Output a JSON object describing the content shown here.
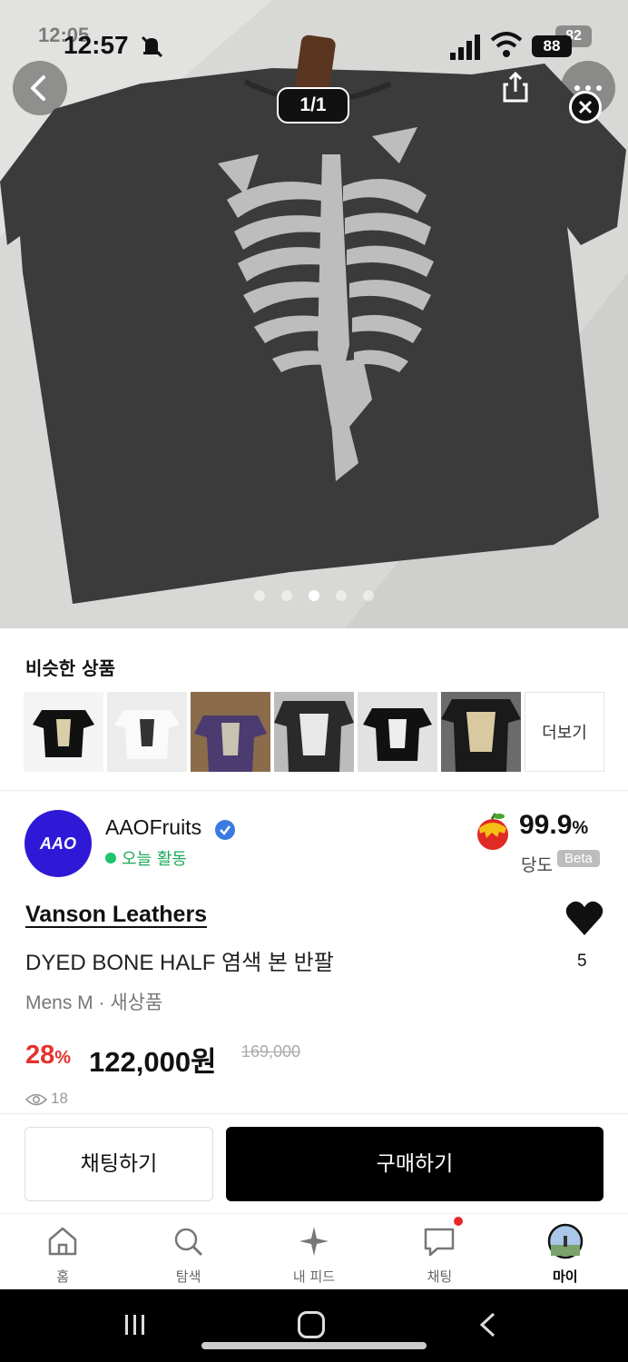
{
  "status_bar": {
    "time": "12:57",
    "time_ghost": "12:05",
    "battery": "88",
    "battery_ghost": "82"
  },
  "hero": {
    "counter": "1/1",
    "dots_count": 5,
    "active_dot": 2
  },
  "similar": {
    "title": "비슷한 상품",
    "more_label": "더보기"
  },
  "seller": {
    "avatar_text": "AAO",
    "name": "AAOFruits",
    "online_text": "오늘 활동",
    "rating_value": "99.9",
    "rating_unit": "%",
    "sweetness_label": "당도",
    "beta_label": "Beta"
  },
  "product": {
    "brand": "Vanson Leathers",
    "name": "DYED BONE HALF 염색 본 반팔",
    "meta": "Mens M · 새상품",
    "discount_value": "28",
    "discount_unit": "%",
    "price": "122,000원",
    "original_price": "169,000",
    "likes": "5",
    "views": "18"
  },
  "actions": {
    "chat_label": "채팅하기",
    "buy_label": "구매하기"
  },
  "nav": {
    "items": [
      {
        "label": "홈",
        "icon": "home-icon"
      },
      {
        "label": "탐색",
        "icon": "search-icon"
      },
      {
        "label": "내 피드",
        "icon": "sparkle-icon"
      },
      {
        "label": "채팅",
        "icon": "chat-icon"
      },
      {
        "label": "마이",
        "icon": "profile-avatar"
      }
    ]
  },
  "colors": {
    "accent_red": "#e6322d",
    "online_green": "#1ec46a",
    "seller_blue": "#2f19d6"
  }
}
